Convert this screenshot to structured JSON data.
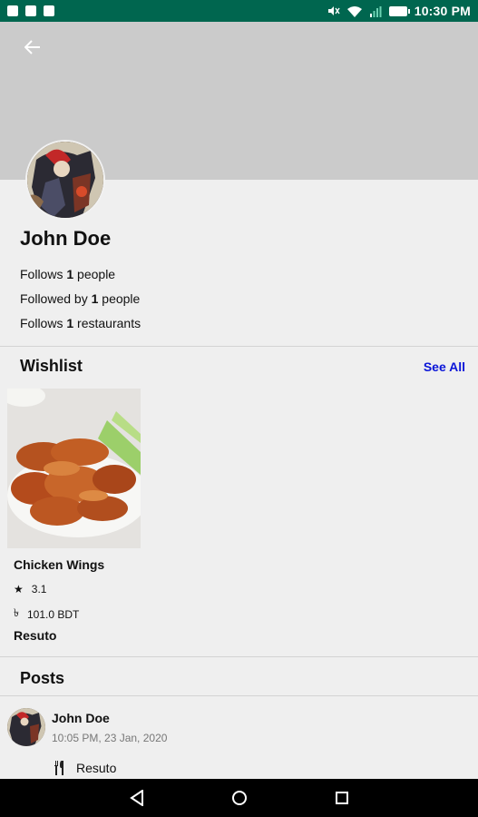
{
  "status_bar": {
    "time": "10:30 PM",
    "icons": [
      "photo-icon",
      "sd-card-icon",
      "message-icon",
      "mute-icon",
      "wifi-icon",
      "no-signal-icon",
      "battery-icon"
    ]
  },
  "header": {
    "back_icon": "back-arrow-icon",
    "cover_color": "#cbcbcb"
  },
  "profile": {
    "name": "John Doe",
    "stats": [
      {
        "prefix": "Follows ",
        "count": "1",
        "suffix": " people"
      },
      {
        "prefix": "Followed by ",
        "count": "1",
        "suffix": " people"
      },
      {
        "prefix": "Follows ",
        "count": "1",
        "suffix": " restaurants"
      }
    ]
  },
  "wishlist": {
    "title": "Wishlist",
    "see_all": "See All",
    "see_all_color": "#0a15d8",
    "items": [
      {
        "name": "Chicken Wings",
        "rating": "3.1",
        "price": "101.0 BDT",
        "restaurant": "Resuto"
      }
    ]
  },
  "posts": {
    "title": "Posts",
    "items": [
      {
        "author": "John Doe",
        "time": "10:05 PM, 23 Jan, 2020",
        "restaurant": "Resuto"
      }
    ]
  },
  "nav_bar": {
    "buttons": [
      "back-triangle-icon",
      "home-circle-icon",
      "recents-square-icon"
    ]
  }
}
